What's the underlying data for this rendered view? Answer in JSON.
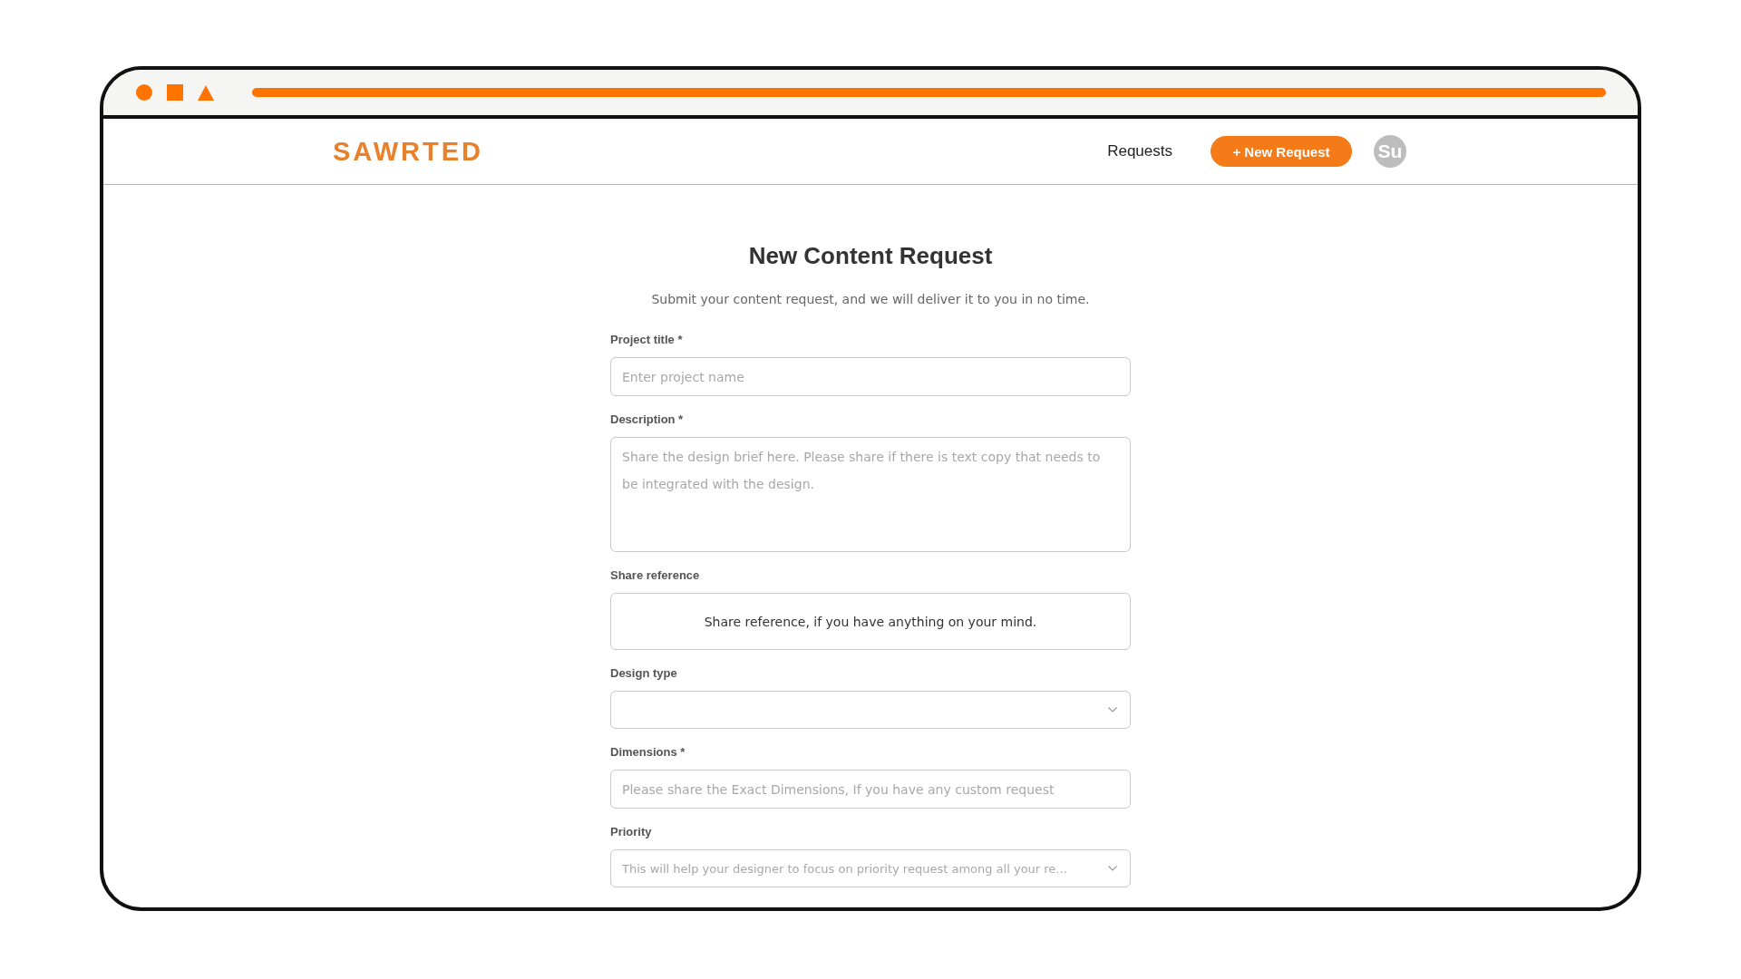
{
  "header": {
    "logo": "SAWRTED",
    "nav_link": "Requests",
    "new_request_button": "+ New Request",
    "avatar_initials": "Su"
  },
  "form": {
    "title": "New Content Request",
    "subtitle": "Submit your content request, and we will deliver it to you in no time.",
    "fields": [
      {
        "kind": "text",
        "label": "Project title *",
        "placeholder": "Enter project name"
      },
      {
        "kind": "textarea",
        "label": "Description *",
        "placeholder": "Share the design brief here. Please share if there is text copy that needs to be integrated with the design."
      },
      {
        "kind": "dropzone",
        "label": "Share reference",
        "prompt": "Share reference, if you have anything on your mind."
      },
      {
        "kind": "select",
        "label": "Design type"
      },
      {
        "kind": "text",
        "label": "Dimensions *",
        "placeholder": "Please share the Exact Dimensions, If you have any custom request"
      },
      {
        "kind": "select",
        "label": "Priority",
        "placeholder": "This will help your designer to focus on priority request among all your re..."
      }
    ]
  }
}
